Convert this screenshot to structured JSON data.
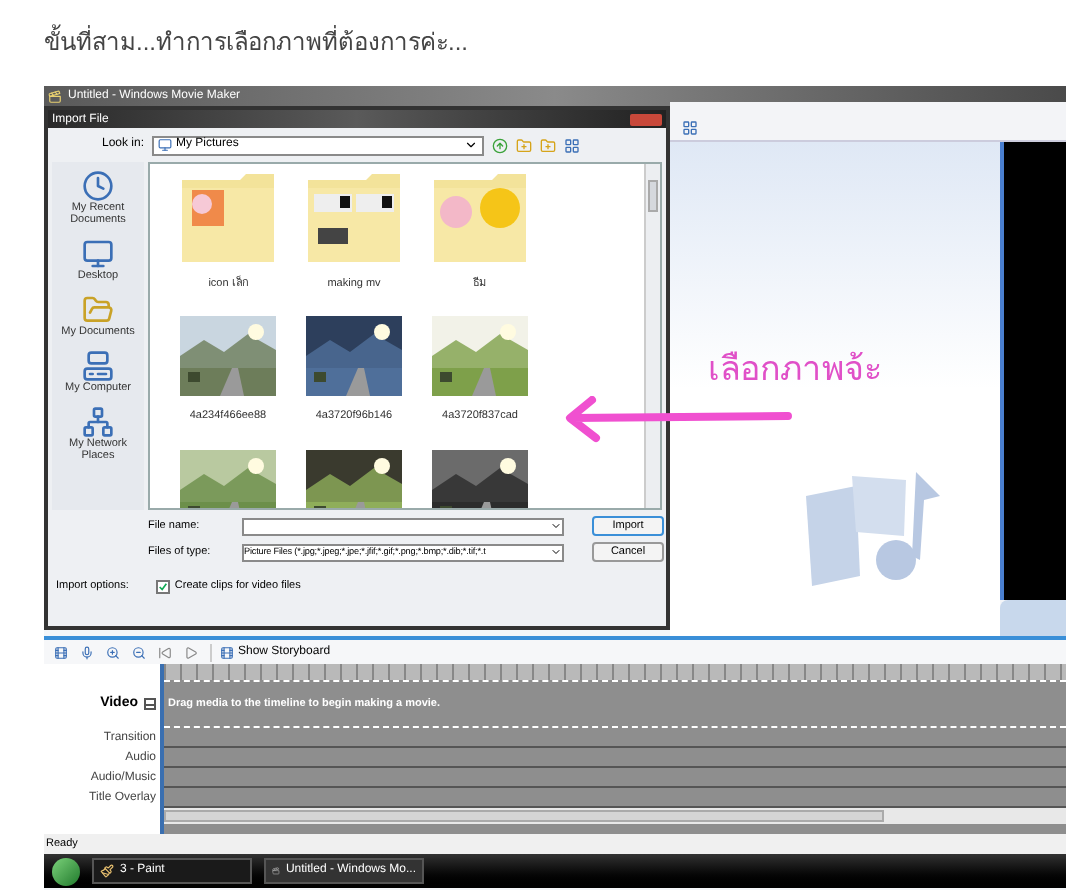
{
  "heading": "ขั้นที่สาม...ทำการเลือกภาพที่ต้องการค่ะ...",
  "window": {
    "title": "Untitled - Windows Movie Maker"
  },
  "dialog": {
    "title": "Import File",
    "look_in": {
      "label": "Look in:",
      "value": "My Pictures"
    },
    "places": [
      {
        "kind": "recent",
        "label": "My Recent Documents"
      },
      {
        "kind": "desktop",
        "label": "Desktop"
      },
      {
        "kind": "documents",
        "label": "My Documents"
      },
      {
        "kind": "computer",
        "label": "My Computer"
      },
      {
        "kind": "network",
        "label": "My Network Places"
      }
    ],
    "files": [
      {
        "kind": "folder",
        "label": "icon เล็ก"
      },
      {
        "kind": "folder",
        "label": "making mv"
      },
      {
        "kind": "folder",
        "label": "ธีม"
      },
      {
        "kind": "picture",
        "label": "4a234f466ee88"
      },
      {
        "kind": "picture",
        "label": "4a3720f96b146"
      },
      {
        "kind": "picture",
        "label": "4a3720f837cad"
      },
      {
        "kind": "picture"
      },
      {
        "kind": "picture"
      },
      {
        "kind": "picture"
      }
    ],
    "file_name": {
      "label": "File name:"
    },
    "file_type": {
      "label": "Files of type:",
      "value": "Picture Files (*.jpg;*.jpeg;*.jpe;*.jfif;*.gif;*.png;*.bmp;*.dib;*.tif;*.t"
    },
    "buttons": [
      "Import",
      "Cancel"
    ],
    "import_options": {
      "label": "Import options:",
      "checkbox": {
        "label": "Create clips for video files",
        "checked": true
      }
    }
  },
  "annotation": {
    "text": "เลือกภาพจ้ะ"
  },
  "timeline": {
    "show_storyboard": "Show Storyboard",
    "hint": "Drag media to the timeline to begin making a movie.",
    "tracks": [
      {
        "kind": "video",
        "label": "Video",
        "expanded": true
      },
      {
        "kind": "plain",
        "label": "Transition"
      },
      {
        "kind": "plain",
        "label": "Audio"
      },
      {
        "kind": "plain",
        "label": "Audio/Music"
      },
      {
        "kind": "plain",
        "label": "Title Overlay"
      }
    ]
  },
  "status_bar": "Ready",
  "taskbar": [
    {
      "label": "3 - Paint",
      "kind": "paint"
    },
    {
      "label": "Untitled - Windows Mo...",
      "kind": "movie"
    }
  ]
}
